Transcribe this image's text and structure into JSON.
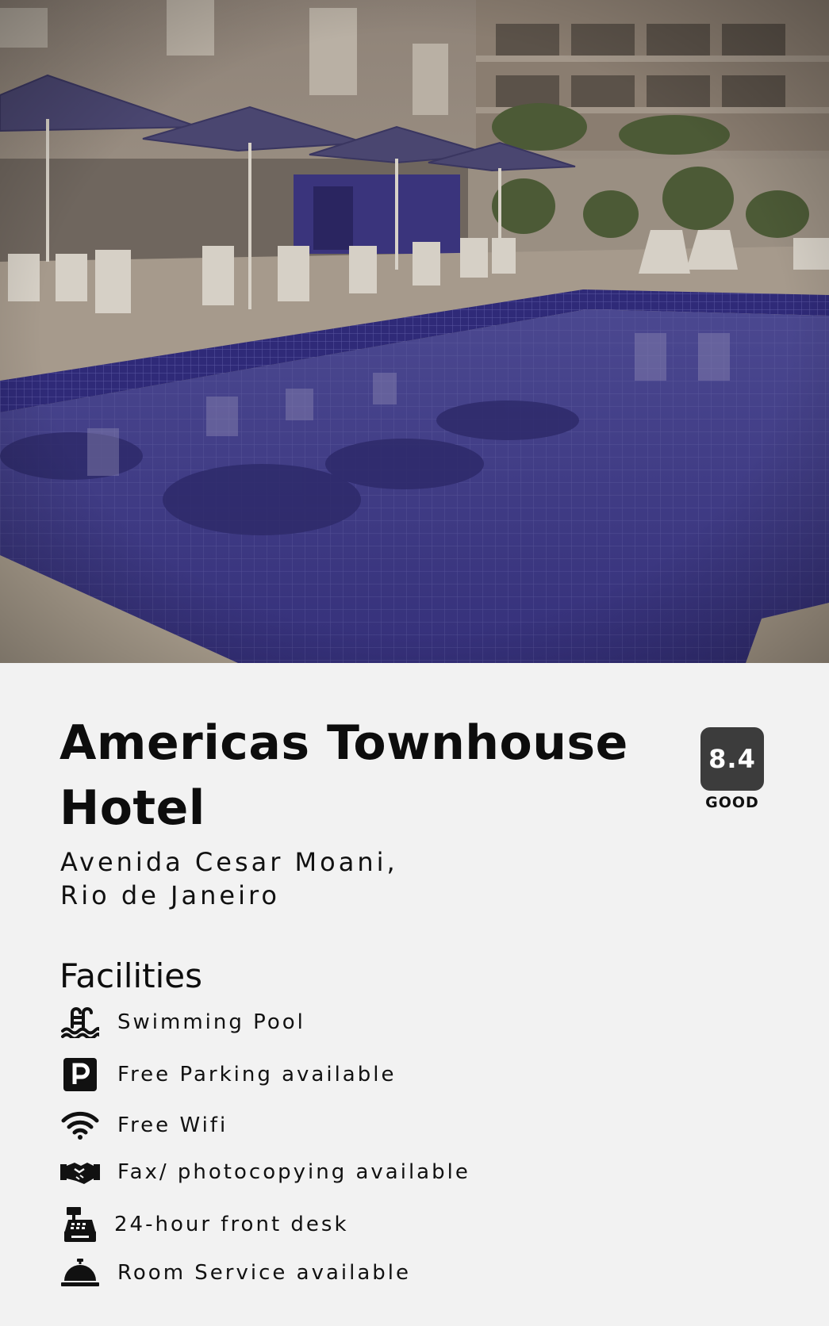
{
  "hotel": {
    "name": "Americas Townhouse Hotel",
    "address_line1": "Avenida Cesar Moani,",
    "address_line2": "Rio de Janeiro",
    "rating_score": "8.4",
    "rating_label": "GOOD"
  },
  "facilities": {
    "title": "Facilities",
    "items": [
      {
        "label": "Swimming Pool",
        "icon": "swimming-pool-icon"
      },
      {
        "label": "Free Parking available",
        "icon": "parking-icon"
      },
      {
        "label": "Free Wifi",
        "icon": "wifi-icon"
      },
      {
        "label": "Fax/ photocopying available",
        "icon": "handshake-icon"
      },
      {
        "label": "24-hour front desk",
        "icon": "cash-register-icon"
      },
      {
        "label": "Room Service available",
        "icon": "service-bell-icon"
      }
    ]
  },
  "colors": {
    "background": "#f2f2f2",
    "rating_badge": "#3c3c3c",
    "pool_water": "#3d3a8a"
  }
}
